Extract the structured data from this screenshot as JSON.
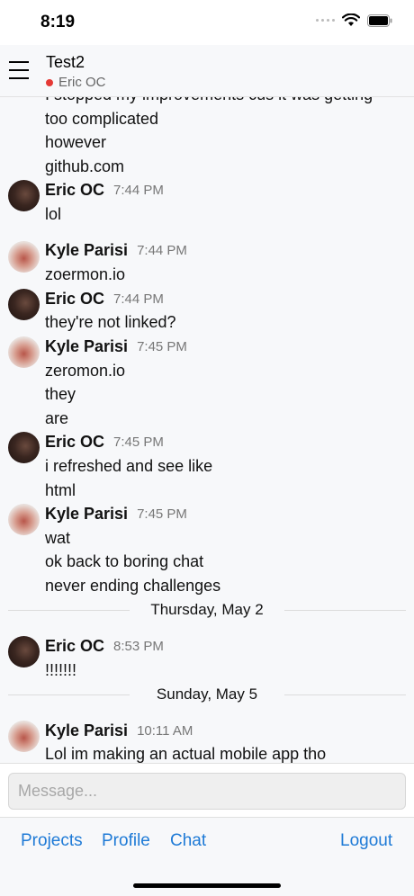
{
  "status_bar": {
    "time": "8:19"
  },
  "header": {
    "title": "Test2",
    "subtitle": "Eric OC"
  },
  "messages": [
    {
      "type": "cont",
      "text": "I stopped my improvements cus it was getting"
    },
    {
      "type": "cont",
      "text": "too complicated"
    },
    {
      "type": "cont",
      "text": "however"
    },
    {
      "type": "cont",
      "text": "github.com"
    },
    {
      "type": "head",
      "author": "Eric OC",
      "time": "7:44 PM",
      "avatar": "eric"
    },
    {
      "type": "cont",
      "text": "lol"
    },
    {
      "type": "gap"
    },
    {
      "type": "head",
      "author": "Kyle Parisi",
      "time": "7:44 PM",
      "avatar": "kyle"
    },
    {
      "type": "cont",
      "text": "zoermon.io"
    },
    {
      "type": "head",
      "author": "Eric OC",
      "time": "7:44 PM",
      "avatar": "eric"
    },
    {
      "type": "cont",
      "text": "they're not linked?"
    },
    {
      "type": "head",
      "author": "Kyle Parisi",
      "time": "7:45 PM",
      "avatar": "kyle"
    },
    {
      "type": "cont",
      "text": "zeromon.io"
    },
    {
      "type": "cont",
      "text": "they"
    },
    {
      "type": "cont",
      "text": "are"
    },
    {
      "type": "head",
      "author": "Eric OC",
      "time": "7:45 PM",
      "avatar": "eric"
    },
    {
      "type": "cont",
      "text": "i refreshed and see like"
    },
    {
      "type": "cont",
      "text": "html"
    },
    {
      "type": "head",
      "author": "Kyle Parisi",
      "time": "7:45 PM",
      "avatar": "kyle"
    },
    {
      "type": "cont",
      "text": "wat"
    },
    {
      "type": "cont",
      "text": "ok back to boring chat"
    },
    {
      "type": "cont",
      "text": "never ending challenges"
    },
    {
      "type": "date",
      "text": "Thursday, May 2"
    },
    {
      "type": "gap"
    },
    {
      "type": "head",
      "author": "Eric OC",
      "time": "8:53 PM",
      "avatar": "eric"
    },
    {
      "type": "cont",
      "text": "!!!!!!!"
    },
    {
      "type": "date",
      "text": "Sunday, May 5"
    },
    {
      "type": "gap"
    },
    {
      "type": "head",
      "author": "Kyle Parisi",
      "time": "10:11 AM",
      "avatar": "kyle"
    },
    {
      "type": "cont",
      "text": "Lol im making an actual mobile app tho"
    }
  ],
  "composer": {
    "placeholder": "Message..."
  },
  "tabbar": {
    "projects": "Projects",
    "profile": "Profile",
    "chat": "Chat",
    "logout": "Logout"
  },
  "colors": {
    "accent": "#1e7ad6",
    "online": "#e53935",
    "background": "#f7f8fa"
  }
}
